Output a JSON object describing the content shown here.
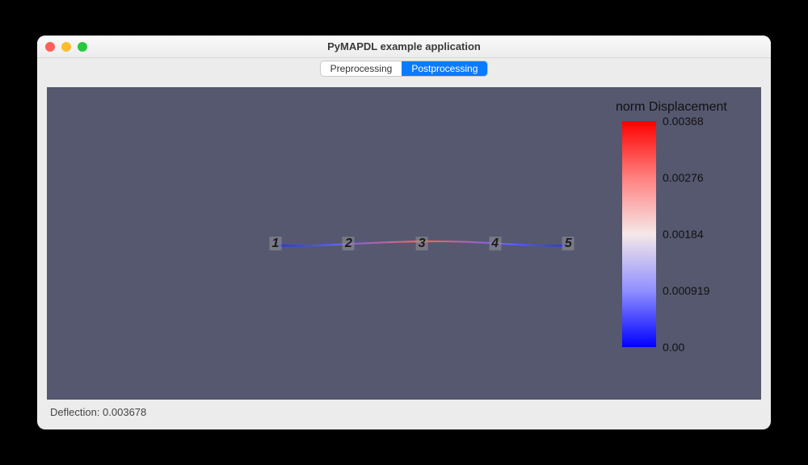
{
  "window": {
    "title": "PyMAPDL example application"
  },
  "tabs": {
    "items": [
      {
        "label": "Preprocessing",
        "active": false
      },
      {
        "label": "Postprocessing",
        "active": true
      }
    ]
  },
  "viewport": {
    "background": "#55586f",
    "nodes": [
      "1",
      "2",
      "3",
      "4",
      "5"
    ]
  },
  "colorbar": {
    "title": "norm Displacement",
    "ticks": [
      "0.00368",
      "0.00276",
      "0.00184",
      "0.000919",
      "0.00"
    ],
    "gradient_top": "#ff0000",
    "gradient_mid": "#f5e8e8",
    "gradient_bottom": "#0000ff"
  },
  "status": {
    "deflection_label": "Deflection: 0.003678"
  }
}
